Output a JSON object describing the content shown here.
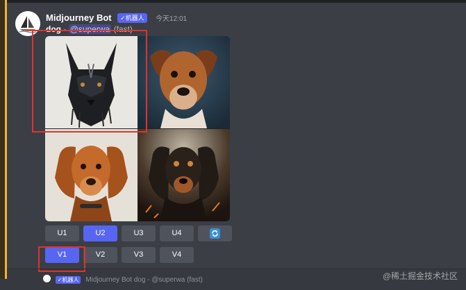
{
  "message": {
    "username": "Midjourney Bot",
    "bot_badge": "✓机器人",
    "timestamp": "今天12:01",
    "prompt": "dog",
    "separator": "-",
    "mention": "@superwa",
    "speed": "(fast)"
  },
  "image_grid": {
    "images": [
      "dog-ink-portrait",
      "dog-brown-portrait",
      "dog-spaniel-portrait",
      "dog-dark-spaniel-portrait"
    ]
  },
  "buttons": {
    "upscale": [
      {
        "label": "U1",
        "active": false
      },
      {
        "label": "U2",
        "active": true
      },
      {
        "label": "U3",
        "active": false
      },
      {
        "label": "U4",
        "active": false
      }
    ],
    "reroll_icon": "refresh-icon",
    "variation": [
      {
        "label": "V1",
        "active": true
      },
      {
        "label": "V2",
        "active": false
      },
      {
        "label": "V3",
        "active": false
      },
      {
        "label": "V4",
        "active": false
      }
    ]
  },
  "next_message": {
    "badge": "✓机器人",
    "username": "Midjourney Bot",
    "prompt": "dog",
    "separator": "-",
    "mention": "@superwa",
    "speed": "(fast)"
  },
  "watermark": "@稀土掘金技术社区",
  "colors": {
    "accent": "#5865f2",
    "highlight": "#e03232",
    "gutter": "#f0b232"
  }
}
